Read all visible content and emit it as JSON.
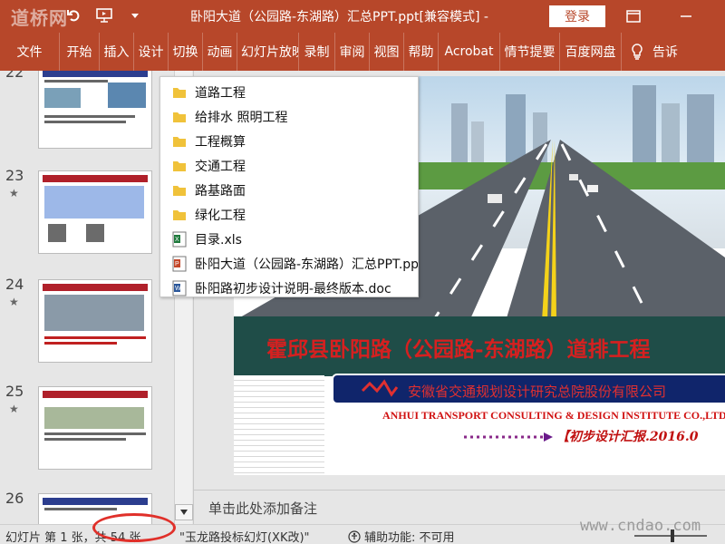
{
  "titlebar": {
    "logo": "道桥网",
    "title": "卧阳大道（公园路-东湖路）汇总PPT.ppt[兼容模式]  -",
    "login": "登录"
  },
  "ribbon": {
    "tabs": [
      "文件",
      "开始",
      "插入",
      "设计",
      "切换",
      "动画",
      "幻灯片放映",
      "录制",
      "审阅",
      "视图",
      "帮助",
      "Acrobat",
      "情节提要",
      "百度网盘"
    ],
    "tell": "告诉"
  },
  "thumbnails": {
    "numbers": [
      "22",
      "23",
      "24",
      "25",
      "26"
    ]
  },
  "popup": {
    "items": [
      {
        "label": "道路工程",
        "icon": "folder-icon"
      },
      {
        "label": "给排水 照明工程",
        "icon": "folder-icon"
      },
      {
        "label": "工程概算",
        "icon": "folder-icon"
      },
      {
        "label": "交通工程",
        "icon": "folder-icon"
      },
      {
        "label": "路基路面",
        "icon": "folder-icon"
      },
      {
        "label": "绿化工程",
        "icon": "folder-icon"
      },
      {
        "label": "目录.xls",
        "icon": "excel-file-icon"
      },
      {
        "label": "卧阳大道（公园路-东湖路）汇总PPT.ppt",
        "icon": "ppt-file-icon"
      },
      {
        "label": "卧阳路初步设计说明-最终版本.doc",
        "icon": "word-file-icon"
      }
    ]
  },
  "slide": {
    "title": "霍邱县卧阳路（公园路-东湖路）道排工程",
    "org": "安徽省交通规划设计研究总院股份有限公司",
    "org_en": "ANHUI TRANSPORT CONSULTING & DESIGN INSTITUTE CO.,LTD",
    "stage": "【初步设计汇报.2016.0"
  },
  "notes": {
    "placeholder": "单击此处添加备注"
  },
  "status": {
    "slide_no": "幻灯片 第 1 张，共 54 张",
    "theme": "\"玉龙路投标幻灯(XK改)\"",
    "accessibility": "辅助功能: 不可用",
    "site": "www.cndao.com"
  },
  "colors": {
    "accent": "#b7472a",
    "annotation": "#e0302a"
  }
}
